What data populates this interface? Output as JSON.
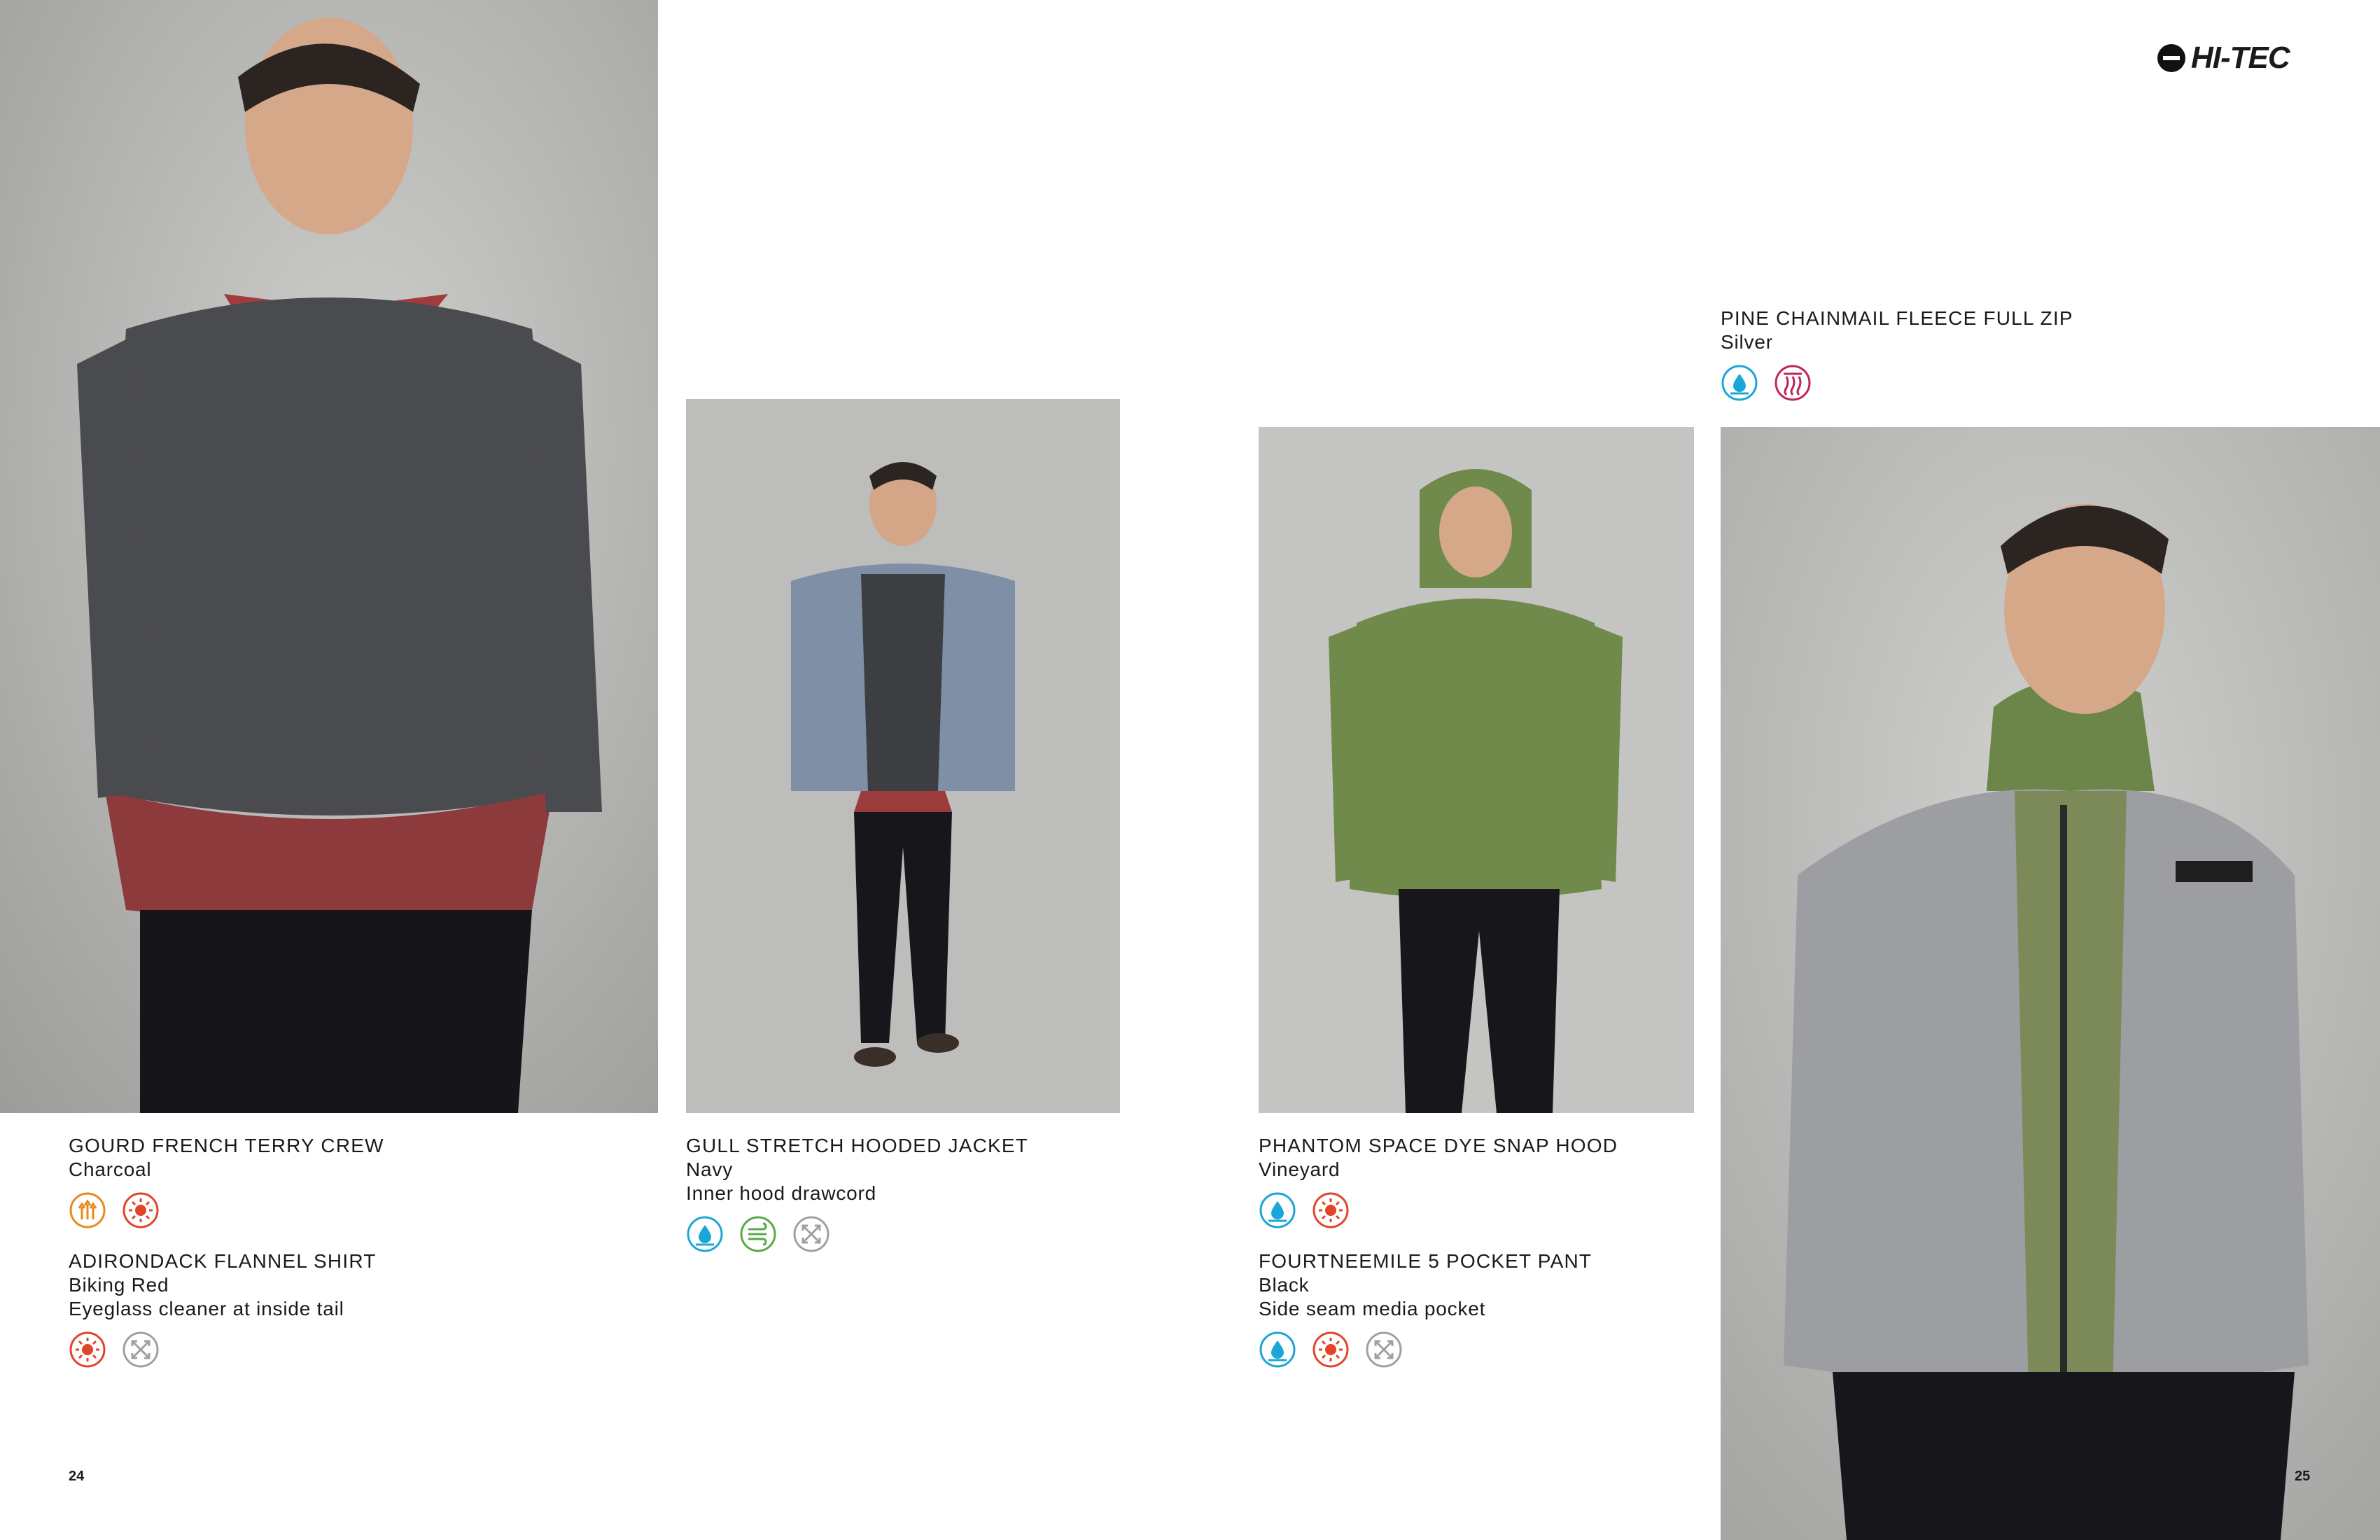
{
  "brand": {
    "name": "HI-TEC"
  },
  "pages": {
    "left": "24",
    "right": "25"
  },
  "products": {
    "gourd": {
      "name": "GOURD FRENCH TERRY CREW",
      "color": "Charcoal"
    },
    "adirondack": {
      "name": "ADIRONDACK FLANNEL SHIRT",
      "color": "Biking Red",
      "feature": "Eyeglass cleaner at inside tail"
    },
    "gull": {
      "name": "GULL STRETCH HOODED JACKET",
      "color": "Navy",
      "feature": "Inner hood drawcord"
    },
    "phantom": {
      "name": "PHANTOM SPACE DYE SNAP HOOD",
      "color": "Vineyard"
    },
    "fourtneemile": {
      "name": "FOURTNEEMILE 5 POCKET PANT",
      "color": "Black",
      "feature": "Side seam media pocket"
    },
    "pine": {
      "name": "PINE CHAINMAIL FLEECE FULL ZIP",
      "color": "Silver"
    }
  },
  "icon_colors": {
    "breathable": "#e8891e",
    "uv": "#e2442a",
    "water": "#1aa6d6",
    "wind": "#5aa846",
    "stretch": "#a0a0a0",
    "thermal": "#c0245c"
  }
}
